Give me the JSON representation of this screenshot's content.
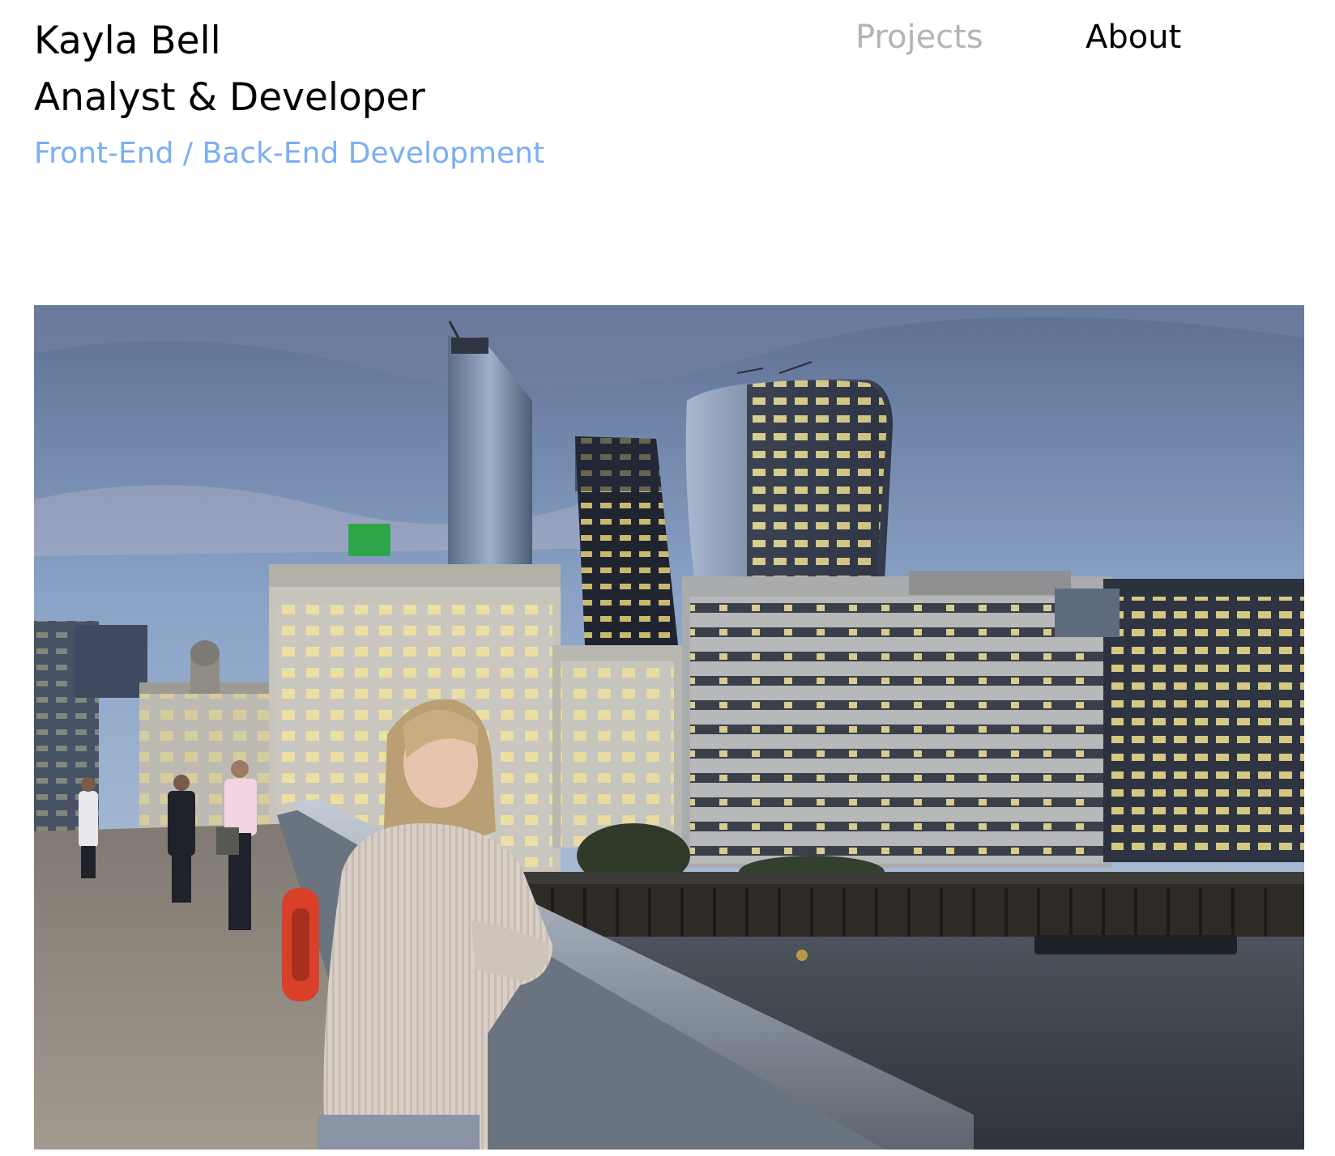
{
  "header": {
    "name": "Kayla Bell",
    "role": "Analyst & Developer",
    "tagline": "Front-End / Back-End Development"
  },
  "nav": {
    "projects": "Projects",
    "about": "About",
    "active": "About"
  },
  "colors": {
    "tagline": "#7aaef5",
    "nav_inactive": "#b4b4b4",
    "nav_active": "#000000"
  },
  "hero": {
    "content": "photo"
  }
}
